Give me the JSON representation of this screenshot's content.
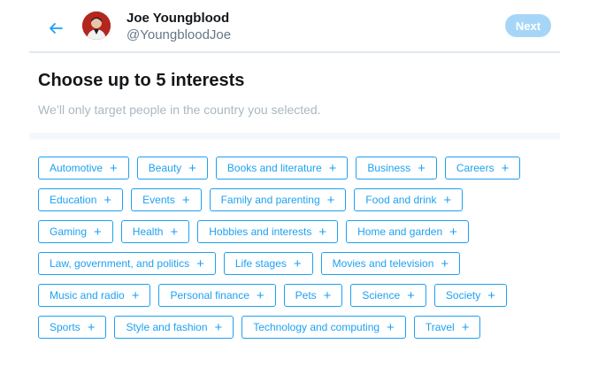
{
  "header": {
    "display_name": "Joe Youngblood",
    "username": "@YoungbloodJoe",
    "next_label": "Next"
  },
  "main": {
    "title": "Choose up to 5 interests",
    "subtitle": "We’ll only target people in the country you selected."
  },
  "interests": {
    "rows": [
      [
        "Automotive",
        "Beauty",
        "Books and literature",
        "Business",
        "Careers"
      ],
      [
        "Education",
        "Events",
        "Family and parenting",
        "Food and drink"
      ],
      [
        "Gaming",
        "Health",
        "Hobbies and interests",
        "Home and garden"
      ],
      [
        "Law, government, and politics",
        "Life stages",
        "Movies and television"
      ],
      [
        "Music and radio",
        "Personal finance",
        "Pets",
        "Science",
        "Society"
      ],
      [
        "Sports",
        "Style and fashion",
        "Technology and computing",
        "Travel"
      ]
    ],
    "add_icon": "plus-icon"
  },
  "colors": {
    "accent": "#1da1f2",
    "next_button_disabled": "#a6d6f7",
    "subtitle": "#aab8c2",
    "username": "#657786"
  }
}
